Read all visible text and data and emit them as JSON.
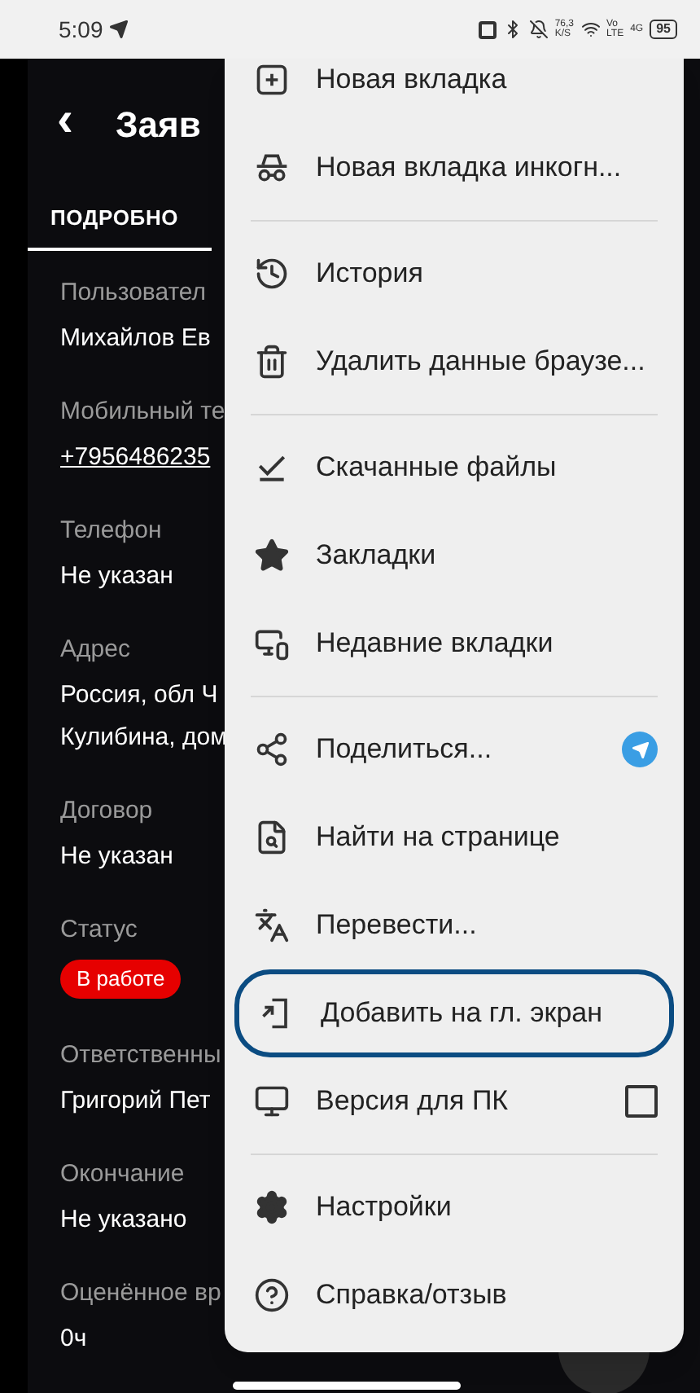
{
  "status_bar": {
    "time": "5:09",
    "speed": "76,3",
    "speed_unit": "K/S",
    "volte": "Vo",
    "lte": "LTE",
    "network": "4G",
    "battery": "95"
  },
  "app": {
    "back": "‹",
    "title": "Заяв",
    "tabs": [
      {
        "label": "ПОДРОБНО",
        "selected": true
      }
    ],
    "fields": [
      {
        "label": "Пользовател",
        "value": "Михайлов Ев",
        "kind": "text"
      },
      {
        "label": "Мобильный те",
        "value": "+7956486235",
        "kind": "link"
      },
      {
        "label": "Телефон",
        "value": "Не указан",
        "kind": "text"
      },
      {
        "label": "Адрес",
        "value": "Россия, обл Ч",
        "value2": "Кулибина, дом",
        "kind": "text"
      },
      {
        "label": "Договор",
        "value": "Не указан",
        "kind": "text"
      },
      {
        "label": "Статус",
        "value": "В работе",
        "kind": "badge"
      },
      {
        "label": "Ответственны",
        "value": "Григорий Пет",
        "kind": "text"
      },
      {
        "label": "Окончание",
        "value": "Не указано",
        "kind": "text"
      },
      {
        "label": "Оценённое вр",
        "value": "0ч",
        "kind": "text"
      }
    ]
  },
  "menu": {
    "items": [
      {
        "kind": "item",
        "label": "Новая вкладка"
      },
      {
        "kind": "item",
        "label": "Новая вкладка инкогн..."
      },
      {
        "kind": "divider"
      },
      {
        "kind": "item",
        "label": "История"
      },
      {
        "kind": "item",
        "label": "Удалить данные браузе..."
      },
      {
        "kind": "divider"
      },
      {
        "kind": "item",
        "label": "Скачанные файлы"
      },
      {
        "kind": "item",
        "label": "Закладки"
      },
      {
        "kind": "item",
        "label": "Недавние вкладки"
      },
      {
        "kind": "divider"
      },
      {
        "kind": "share",
        "label": "Поделиться..."
      },
      {
        "kind": "item",
        "label": "Найти на странице"
      },
      {
        "kind": "item",
        "label": "Перевести..."
      },
      {
        "kind": "item",
        "label": "Добавить на гл. экран",
        "highlighted": true
      },
      {
        "kind": "checkbox",
        "label": "Версия для ПК",
        "checked": false
      },
      {
        "kind": "divider"
      },
      {
        "kind": "item",
        "label": "Настройки"
      },
      {
        "kind": "item",
        "label": "Справка/отзыв"
      }
    ]
  }
}
